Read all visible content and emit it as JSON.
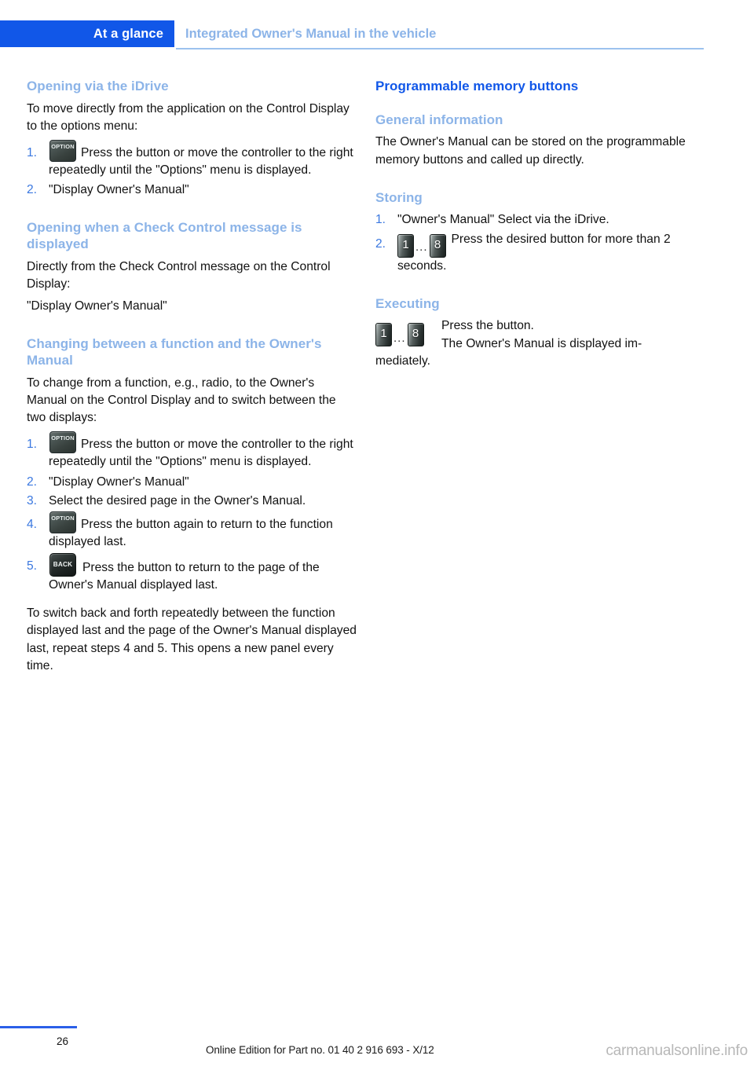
{
  "header": {
    "tab_label": "At a glance",
    "subject": "Integrated Owner's Manual in the vehicle"
  },
  "left_column": {
    "section1": {
      "heading": "Opening via the iDrive",
      "intro": "To move directly from the application on the Control Display to the options menu:",
      "steps": [
        {
          "num": "1.",
          "icon": "option-button-icon",
          "icon_label": "OPTION",
          "text": "Press the button or move the controller to the right repeatedly until the \"Options\" menu is displayed."
        },
        {
          "num": "2.",
          "text": "\"Display Owner's Manual\""
        }
      ]
    },
    "section2": {
      "heading": "Opening when a Check Control message is displayed",
      "intro": "Directly from the Check Control message on the Control Display:",
      "callout": "\"Display Owner's Manual\""
    },
    "section3": {
      "heading": "Changing between a function and the Owner's Manual",
      "intro": "To change from a function, e.g., radio, to the Owner's Manual on the Control Display and to switch between the two displays:",
      "steps": [
        {
          "num": "1.",
          "icon": "option-button-icon",
          "icon_label": "OPTION",
          "text": "Press the button or move the controller to the right repeatedly until the \"Options\" menu is displayed."
        },
        {
          "num": "2.",
          "text": "\"Display Owner's Manual\""
        },
        {
          "num": "3.",
          "text": "Select the desired page in the Owner's Manual."
        },
        {
          "num": "4.",
          "icon": "option-button-icon",
          "icon_label": "OPTION",
          "text": "Press the button again to return to the function displayed last."
        },
        {
          "num": "5.",
          "icon": "back-button-icon",
          "icon_label": "BACK",
          "text": "Press the button to return to the page of the Owner's Manual displayed last."
        }
      ],
      "outro": "To switch back and forth repeatedly between the function displayed last and the page of the Owner's Manual displayed last, repeat steps 4 and 5. This opens a new panel every time."
    }
  },
  "right_column": {
    "chapter_heading": "Programmable memory buttons",
    "section1": {
      "heading": "General information",
      "body": "The Owner's Manual can be stored on the programmable memory buttons and called up directly."
    },
    "section2": {
      "heading": "Storing",
      "steps": [
        {
          "num": "1.",
          "text": "\"Owner's Manual\" Select via the iDrive."
        },
        {
          "num": "2.",
          "icon": "memory-buttons-icon",
          "icon_from": "1",
          "icon_dots": "...",
          "icon_to": "8",
          "text": "Press the desired button for more than 2 seconds."
        }
      ]
    },
    "section3": {
      "heading": "Executing",
      "icon_from": "1",
      "icon_dots": "...",
      "icon_to": "8",
      "line1": "Press the button.",
      "line2": "The Owner's Manual is displayed im-",
      "line3": "mediately."
    }
  },
  "footer": {
    "page_number": "26",
    "note": "Online Edition for Part no. 01 40 2 916 693 - X/12",
    "watermark": "carmanualsonline.info"
  },
  "colors": {
    "tab_background": "#1157e8",
    "chapter_heading": "#1157e8",
    "section_heading": "#8cb4e8",
    "step_number": "#3b78e0",
    "header_rule": "#9cc2ee",
    "footer_rule": "#2b5fe8",
    "body_text": "#111111"
  }
}
